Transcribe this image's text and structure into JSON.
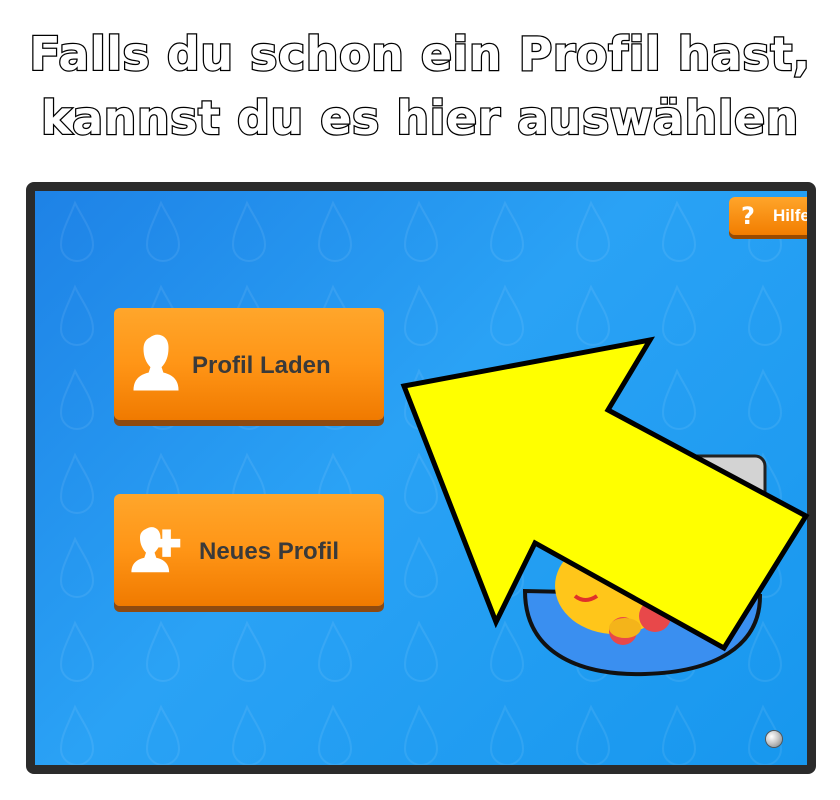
{
  "instruction": {
    "line1": "Falls du schon ein Profil hast,",
    "line2": "kannst du es hier auswählen"
  },
  "help_button": {
    "icon": "question-mark-icon",
    "icon_glyph": "?",
    "label": "Hilfe"
  },
  "menu": {
    "load_profile": {
      "icon": "person-icon",
      "label": "Profil Laden"
    },
    "new_profile": {
      "icon": "add-person-icon",
      "label": "Neues Profil"
    }
  },
  "annotation": {
    "type": "arrow",
    "color": "#ffff00",
    "points_to": "load_profile"
  },
  "colors": {
    "background": "#1e8ae8",
    "button": "#ff9516",
    "button_text": "#3a3a3a",
    "frame": "#2b2b2b"
  }
}
